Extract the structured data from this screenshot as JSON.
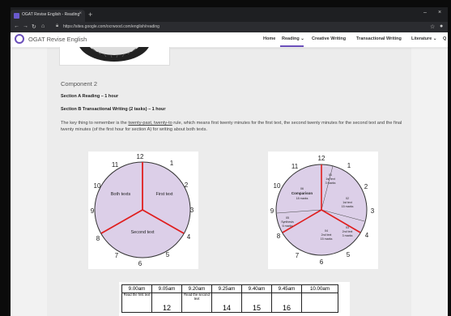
{
  "browser": {
    "tab_title": "OGAT Revise English - Reading",
    "tab_close": "×",
    "new_tab": "+",
    "url": "https://sites.google.com/ocrwood.com/english/reading",
    "win_min": "–",
    "win_close": "×"
  },
  "site": {
    "name": "OGAT Revise English",
    "nav": [
      "Home",
      "Reading ⌄",
      "Creative Writing",
      "Transactional Writing",
      "Literature ⌄",
      "Q"
    ]
  },
  "content": {
    "heading": "Component 2",
    "section_a": "Section A Reading – 1 hour",
    "section_b": "Section B Transactional Writing (2 tasks) – 1 hour",
    "para_pre": "The key thing to remember is the ",
    "para_link": "twenty-past, twenty-to",
    "para_post": " rule, which means first twenty minutes for the first text, the second twenty minutes for the second text and the final twenty minutes (of the first hour for section A) for writing about both texts."
  },
  "clock1": {
    "numbers": [
      "12",
      "1",
      "2",
      "3",
      "4",
      "5",
      "6",
      "7",
      "8",
      "9",
      "10",
      "11"
    ],
    "labels": {
      "both": "Both texts",
      "first": "First text",
      "second": "Second text"
    }
  },
  "clock2": {
    "numbers": [
      "12",
      "1",
      "2",
      "3",
      "4",
      "5",
      "6",
      "7",
      "8",
      "9",
      "10",
      "11"
    ],
    "segments": {
      "s1": [
        "01",
        "1st text",
        "3 marks"
      ],
      "s2": [
        "02",
        "1st text",
        "15 marks"
      ],
      "s3": [
        "03",
        "2nd text",
        "3 marks"
      ],
      "s4": [
        "04",
        "2nd text",
        "15 marks"
      ],
      "s5": [
        "05",
        "Synthesis",
        "6 marks"
      ],
      "s6": [
        "06",
        "Comparison",
        "18 marks"
      ]
    }
  },
  "timetable": {
    "times": [
      "9.00am",
      "9.05am",
      "9.20am",
      "9.25am",
      "9.40am",
      "9.45am",
      "10.00am"
    ],
    "row2": [
      "Read the first text",
      "12",
      "Read the second text",
      "14",
      "15",
      "16",
      ""
    ]
  }
}
